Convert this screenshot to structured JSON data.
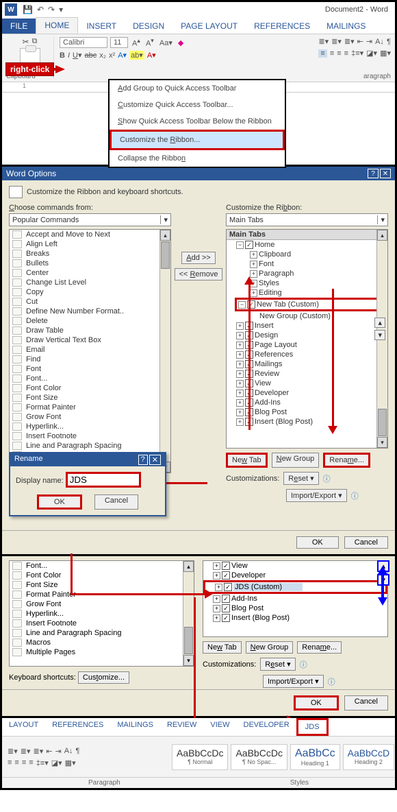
{
  "window_title": "Document2 - Word",
  "tabs": [
    "FILE",
    "HOME",
    "INSERT",
    "DESIGN",
    "PAGE LAYOUT",
    "REFERENCES",
    "MAILINGS"
  ],
  "font": {
    "name": "Calibri",
    "size": "11",
    "style_buttons": [
      "B",
      "I",
      "U",
      "abc",
      "x₂",
      "x²"
    ]
  },
  "aa_buttons": [
    "A",
    "A",
    "Aa"
  ],
  "clipboard_label": "Clipboard",
  "paragraph_label": "aragraph",
  "ruler": "1",
  "callout": "right-click",
  "context_menu": [
    "Add Group to Quick Access Toolbar",
    "Customize Quick Access Toolbar...",
    "Show Quick Access Toolbar Below the Ribbon",
    "Customize the Ribbon...",
    "Collapse the Ribbon"
  ],
  "context_highlight": "Customize the Ribbon...",
  "options": {
    "title": "Word Options",
    "subtitle": "Customize the Ribbon and keyboard shortcuts.",
    "choose_lbl": "Choose commands from:",
    "choose_ddl": "Popular Commands",
    "customize_lbl": "Customize the Ribbon:",
    "customize_ddl": "Main Tabs",
    "commands": [
      "Accept and Move to Next",
      "Align Left",
      "Breaks",
      "Bullets",
      "Center",
      "Change List Level",
      "Copy",
      "Cut",
      "Define New Number Format..",
      "Delete",
      "Draw Table",
      "Draw Vertical Text Box",
      "Email",
      "Find",
      "Font",
      "Font...",
      "Font Color",
      "Font Size",
      "Format Painter",
      "Grow Font",
      "Hyperlink...",
      "Insert Footnote",
      "Line and Paragraph Spacing",
      "Macros",
      "Multiple Pages"
    ],
    "tree_header": "Main Tabs",
    "tree_home": "Home",
    "tree_home_children": [
      "Clipboard",
      "Font",
      "Paragraph",
      "Styles",
      "Editing"
    ],
    "tree_newtab": "New Tab (Custom)",
    "tree_newgroup": "New Group (Custom)",
    "tree_rest": [
      "Insert",
      "Design",
      "Page Layout",
      "References",
      "Mailings",
      "Review",
      "View",
      "Developer",
      "Add-Ins",
      "Blog Post",
      "Insert (Blog Post)"
    ],
    "add": "Add >>",
    "remove": "<< Remove",
    "newtab_btn": "New Tab",
    "newgroup_btn": "New Group",
    "rename_btn": "Rename...",
    "custom_lbl": "Customizations:",
    "reset": "Reset",
    "importexport": "Import/Export",
    "ok": "OK",
    "cancel": "Cancel"
  },
  "rename": {
    "title": "Rename",
    "display_lbl": "Display name:",
    "value": "JDS",
    "ok": "OK",
    "cancel": "Cancel"
  },
  "panel3": {
    "left_commands": [
      "Font...",
      "Font Color",
      "Font Size",
      "Format Painter",
      "Grow Font",
      "Hyperlink...",
      "Insert Footnote",
      "Line and Paragraph Spacing",
      "Macros",
      "Multiple Pages"
    ],
    "right_tree": [
      "View",
      "Developer",
      "JDS (Custom)",
      "Add-Ins",
      "Blog Post",
      "Insert (Blog Post)"
    ],
    "kb_lbl": "Keyboard shortcuts:",
    "customize": "Customize...",
    "newtab": "New Tab",
    "newgroup": "New Group",
    "rename": "Rename...",
    "custom": "Customizations:",
    "reset": "Reset",
    "importexport": "Import/Export",
    "ok": "OK",
    "cancel": "Cancel"
  },
  "panel4": {
    "tabs": [
      "LAYOUT",
      "REFERENCES",
      "MAILINGS",
      "REVIEW",
      "VIEW",
      "DEVELOPER",
      "JDS"
    ],
    "styles": [
      {
        "p": "AaBbCcDc",
        "n": "¶ Normal"
      },
      {
        "p": "AaBbCcDc",
        "n": "¶ No Spac..."
      },
      {
        "p": "AaBbCc",
        "n": "Heading 1"
      },
      {
        "p": "AaBbCcD",
        "n": "Heading 2"
      }
    ],
    "group_labels": [
      "Paragraph",
      "Styles"
    ]
  }
}
